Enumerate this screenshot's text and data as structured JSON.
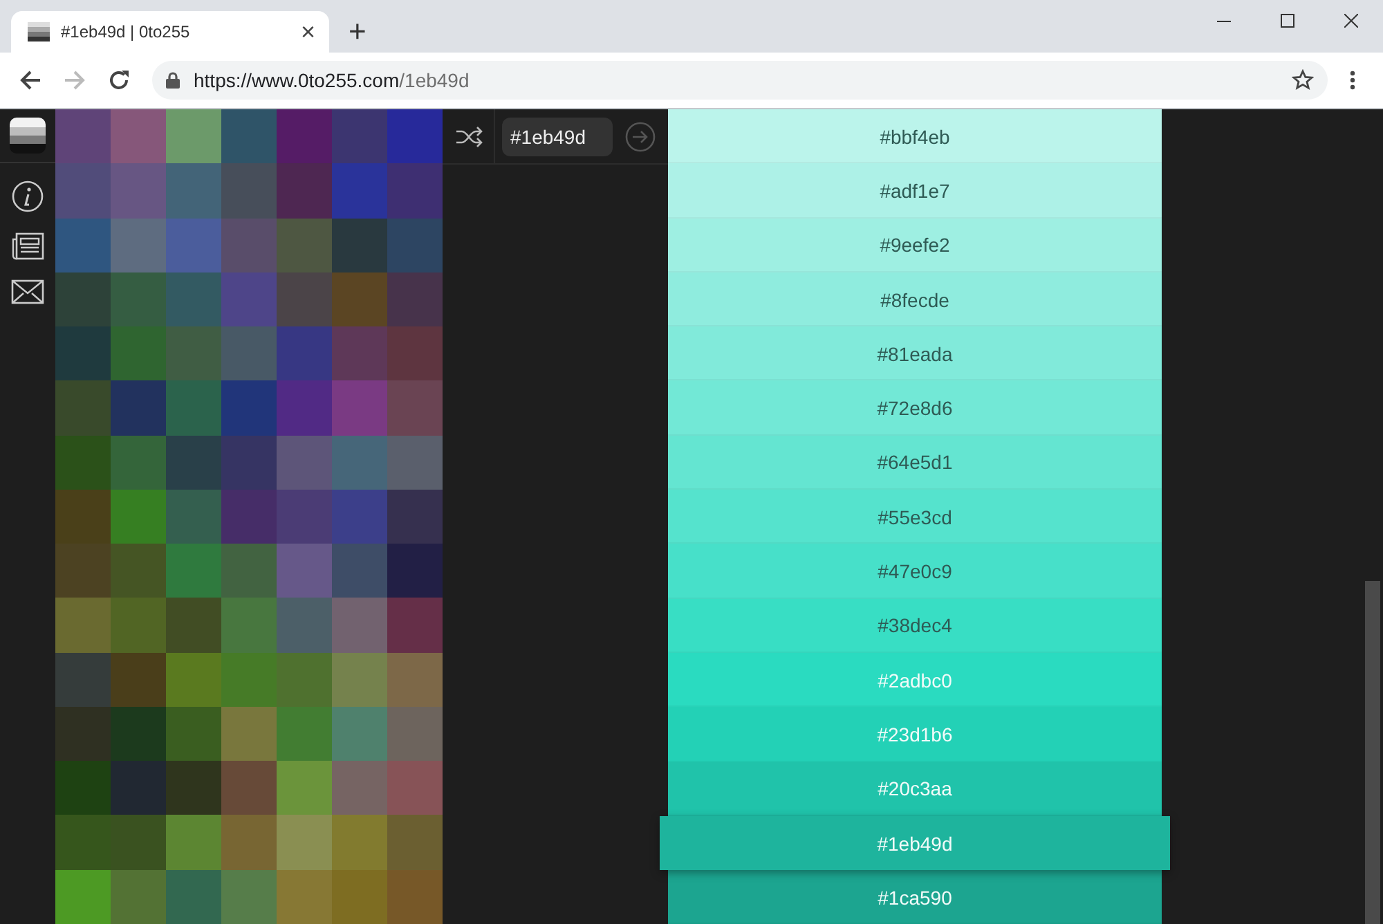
{
  "browser": {
    "tab": {
      "title": "#1eb49d | 0to255",
      "close": "×"
    },
    "new_tab": "+",
    "forward": {
      "disabled": true
    },
    "url": {
      "host": "https://www.0to255.com",
      "path": "/1eb49d"
    }
  },
  "sidebar": {
    "items": [
      {
        "kind": "logo"
      },
      {
        "kind": "info"
      },
      {
        "kind": "news"
      },
      {
        "kind": "mail"
      }
    ]
  },
  "mosaic": {
    "swatches": [
      {
        "color": "#5f4478"
      },
      {
        "color": "#86577a"
      },
      {
        "color": "#6c9a6a"
      },
      {
        "color": "#2f5468"
      },
      {
        "color": "#551c66"
      },
      {
        "color": "#3c3570"
      },
      {
        "color": "#27299a"
      },
      {
        "color": "#514c7a"
      },
      {
        "color": "#675683"
      },
      {
        "color": "#436478"
      },
      {
        "color": "#474e5a"
      },
      {
        "color": "#4e2752"
      },
      {
        "color": "#2a339a"
      },
      {
        "color": "#3e2f72"
      },
      {
        "color": "#2f5680"
      },
      {
        "color": "#5e6c80"
      },
      {
        "color": "#4b5d9c"
      },
      {
        "color": "#594d6a"
      },
      {
        "color": "#4e5742"
      },
      {
        "color": "#29393f"
      },
      {
        "color": "#2d4562"
      },
      {
        "color": "#2d4239"
      },
      {
        "color": "#355d42"
      },
      {
        "color": "#335a62"
      },
      {
        "color": "#4e4589"
      },
      {
        "color": "#4b4448"
      },
      {
        "color": "#5b4523"
      },
      {
        "color": "#47334b"
      },
      {
        "color": "#1f3a3e"
      },
      {
        "color": "#2f6530"
      },
      {
        "color": "#405d44"
      },
      {
        "color": "#485966"
      },
      {
        "color": "#373783"
      },
      {
        "color": "#5e3858"
      },
      {
        "color": "#5e3540"
      },
      {
        "color": "#394a2b"
      },
      {
        "color": "#22325e"
      },
      {
        "color": "#2b634c"
      },
      {
        "color": "#21357a"
      },
      {
        "color": "#512a85"
      },
      {
        "color": "#7a3a83"
      },
      {
        "color": "#6a4453"
      },
      {
        "color": "#2b5119"
      },
      {
        "color": "#34653a"
      },
      {
        "color": "#294049"
      },
      {
        "color": "#363463"
      },
      {
        "color": "#5d5579"
      },
      {
        "color": "#466679"
      },
      {
        "color": "#5a5f6c"
      },
      {
        "color": "#4a4019"
      },
      {
        "color": "#367f22"
      },
      {
        "color": "#345f4f"
      },
      {
        "color": "#462d68"
      },
      {
        "color": "#4b3c75"
      },
      {
        "color": "#3c3f8a"
      },
      {
        "color": "#36304f"
      },
      {
        "color": "#4c4222"
      },
      {
        "color": "#455524"
      },
      {
        "color": "#2f7a3e"
      },
      {
        "color": "#426341"
      },
      {
        "color": "#665889"
      },
      {
        "color": "#3e4d67"
      },
      {
        "color": "#221f45"
      },
      {
        "color": "#6a6a30"
      },
      {
        "color": "#516524"
      },
      {
        "color": "#414d24"
      },
      {
        "color": "#48773f"
      },
      {
        "color": "#4c5f68"
      },
      {
        "color": "#72626f"
      },
      {
        "color": "#652f48"
      },
      {
        "color": "#353c3b"
      },
      {
        "color": "#4a3e1a"
      },
      {
        "color": "#5a7a1f"
      },
      {
        "color": "#467b27"
      },
      {
        "color": "#4f712f"
      },
      {
        "color": "#75824d"
      },
      {
        "color": "#7d6848"
      },
      {
        "color": "#2f3022"
      },
      {
        "color": "#1c3a1d"
      },
      {
        "color": "#3a5e20"
      },
      {
        "color": "#79773d"
      },
      {
        "color": "#427d32"
      },
      {
        "color": "#4f816d"
      },
      {
        "color": "#6d645d"
      },
      {
        "color": "#1e4212"
      },
      {
        "color": "#212832"
      },
      {
        "color": "#2f351d"
      },
      {
        "color": "#674a38"
      },
      {
        "color": "#6b943b"
      },
      {
        "color": "#766463"
      },
      {
        "color": "#875357"
      },
      {
        "color": "#36561c"
      },
      {
        "color": "#3a5220"
      },
      {
        "color": "#5c8632"
      },
      {
        "color": "#786633"
      },
      {
        "color": "#8a8f52"
      },
      {
        "color": "#827b2f"
      },
      {
        "color": "#6b5f31"
      },
      {
        "color": "#4d9a24"
      },
      {
        "color": "#537234"
      },
      {
        "color": "#326850"
      },
      {
        "color": "#567d4a"
      },
      {
        "color": "#877834"
      },
      {
        "color": "#7e6d22"
      },
      {
        "color": "#775828"
      }
    ]
  },
  "toolbar": {
    "color_input": {
      "value": "#1eb49d"
    }
  },
  "shades": [
    {
      "label": "#bbf4eb",
      "color": "#bbf4eb",
      "selected": false
    },
    {
      "label": "#adf1e7",
      "color": "#adf1e7",
      "selected": false
    },
    {
      "label": "#9eefe2",
      "color": "#9eefe2",
      "selected": false
    },
    {
      "label": "#8fecde",
      "color": "#8fecde",
      "selected": false
    },
    {
      "label": "#81eada",
      "color": "#81eada",
      "selected": false
    },
    {
      "label": "#72e8d6",
      "color": "#72e8d6",
      "selected": false
    },
    {
      "label": "#64e5d1",
      "color": "#64e5d1",
      "selected": false
    },
    {
      "label": "#55e3cd",
      "color": "#55e3cd",
      "selected": false
    },
    {
      "label": "#47e0c9",
      "color": "#47e0c9",
      "selected": false
    },
    {
      "label": "#38dec4",
      "color": "#38dec4",
      "selected": false
    },
    {
      "label": "#2adbc0",
      "color": "#2adbc0",
      "selected": false
    },
    {
      "label": "#23d1b6",
      "color": "#23d1b6",
      "selected": false
    },
    {
      "label": "#20c3aa",
      "color": "#20c3aa",
      "selected": false
    },
    {
      "label": "#1eb49d",
      "color": "#1eb49d",
      "selected": true
    },
    {
      "label": "#1ca590",
      "color": "#1ca590",
      "selected": false
    }
  ]
}
